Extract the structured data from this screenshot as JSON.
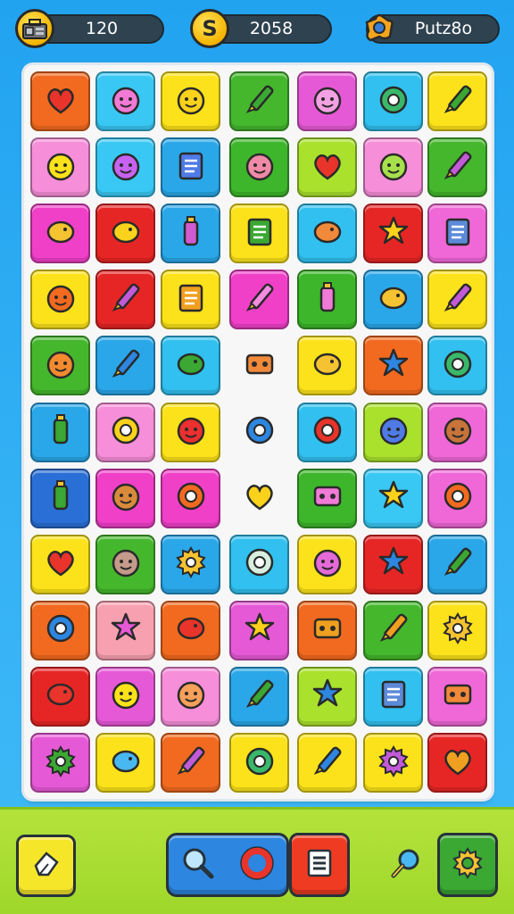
{
  "hud": {
    "stat_left": {
      "value": "120",
      "icon": "toolbox-icon"
    },
    "stat_mid": {
      "value": "2058",
      "icon": "coin-s-icon"
    },
    "stat_right": {
      "value": "Putz8o",
      "icon": "puzzle-piece-icon"
    }
  },
  "board": {
    "rows": [
      [
        {
          "color": "#f26a1f",
          "icon": "apple-icon"
        },
        {
          "color": "#39c8f3",
          "icon": "berry-face-icon"
        },
        {
          "color": "#fbe21b",
          "icon": "sun-face-icon"
        },
        {
          "color": "#45b72d",
          "icon": "brush-icon"
        },
        {
          "color": "#e659d6",
          "icon": "girl-face-icon"
        },
        {
          "color": "#31c0ef",
          "icon": "ring-icon"
        },
        {
          "color": "#fbe21b",
          "icon": "cross-bandage-icon"
        }
      ],
      [
        {
          "color": "#f68ed9",
          "icon": "smiley-icon"
        },
        {
          "color": "#39c8f3",
          "icon": "grape-face-icon"
        },
        {
          "color": "#2aa7e8",
          "icon": "battery-icon"
        },
        {
          "color": "#3db62b",
          "icon": "heart-face-icon"
        },
        {
          "color": "#a9e12d",
          "icon": "strawberry-icon"
        },
        {
          "color": "#f68ed9",
          "icon": "frog-face-icon"
        },
        {
          "color": "#45b72d",
          "icon": "crayon-icon"
        }
      ],
      [
        {
          "color": "#f040c8",
          "icon": "fish-icon"
        },
        {
          "color": "#e62625",
          "icon": "hand-icon"
        },
        {
          "color": "#2aa7e8",
          "icon": "jar-icon"
        },
        {
          "color": "#fbe21b",
          "icon": "ticket-icon"
        },
        {
          "color": "#31c0ef",
          "icon": "cone-icon"
        },
        {
          "color": "#e62625",
          "icon": "flowers-icon"
        },
        {
          "color": "#f068d8",
          "icon": "notebook-icon"
        }
      ],
      [
        {
          "color": "#fbe21b",
          "icon": "bug-face-icon"
        },
        {
          "color": "#e62625",
          "icon": "note-pencil-icon"
        },
        {
          "color": "#fbe21b",
          "icon": "calculator-icon"
        },
        {
          "color": "#f040c8",
          "icon": "eraser-icon"
        },
        {
          "color": "#3db62b",
          "icon": "cup-icon"
        },
        {
          "color": "#2aa7e8",
          "icon": "chick-icon"
        },
        {
          "color": "#fbe21b",
          "icon": "marker-icon"
        }
      ],
      [
        {
          "color": "#45b72d",
          "icon": "orange-face-icon"
        },
        {
          "color": "#2aa7e8",
          "icon": "paint-brush-icon"
        },
        {
          "color": "#31c0ef",
          "icon": "lollipop-icon"
        },
        {
          "color": "",
          "icon": "robot-head-icon"
        },
        {
          "color": "#fbe21b",
          "icon": "candy-icon"
        },
        {
          "color": "#f26a1f",
          "icon": "splat-icon"
        },
        {
          "color": "#31c0ef",
          "icon": "cookie-icon"
        }
      ],
      [
        {
          "color": "#2aa7e8",
          "icon": "bottle-icon"
        },
        {
          "color": "#f68ed9",
          "icon": "lemon-icon"
        },
        {
          "color": "#fbe21b",
          "icon": "devil-face-icon"
        },
        {
          "color": "",
          "icon": "button-icon"
        },
        {
          "color": "#31c0ef",
          "icon": "red-ball-icon"
        },
        {
          "color": "#a9e12d",
          "icon": "blob-face-icon"
        },
        {
          "color": "#f068d8",
          "icon": "monkey-face-icon"
        }
      ],
      [
        {
          "color": "#2a6fd6",
          "icon": "glue-icon"
        },
        {
          "color": "#f040c8",
          "icon": "lion-face-icon"
        },
        {
          "color": "#f040c8",
          "icon": "donut-icon"
        },
        {
          "color": "",
          "icon": "leaf-icon"
        },
        {
          "color": "#3db62b",
          "icon": "toy-car-icon"
        },
        {
          "color": "#39c8f3",
          "icon": "star-flower-icon"
        },
        {
          "color": "#f068d8",
          "icon": "target-icon"
        }
      ],
      [
        {
          "color": "#fbe21b",
          "icon": "balloon-icon"
        },
        {
          "color": "#45b72d",
          "icon": "onion-face-icon"
        },
        {
          "color": "#2aa7e8",
          "icon": "gear-sun-icon"
        },
        {
          "color": "#31c0ef",
          "icon": "clock-icon"
        },
        {
          "color": "#fbe21b",
          "icon": "pig-face-icon"
        },
        {
          "color": "#e62625",
          "icon": "star-icon"
        },
        {
          "color": "#2aa7e8",
          "icon": "wand-icon"
        }
      ],
      [
        {
          "color": "#f26a1f",
          "icon": "ring-blue-icon"
        },
        {
          "color": "#f7a0b0",
          "icon": "puffball-icon"
        },
        {
          "color": "#f26a1f",
          "icon": "ice-pop-icon"
        },
        {
          "color": "#e659d6",
          "icon": "flower-badge-icon"
        },
        {
          "color": "#f26a1f",
          "icon": "lock-icon"
        },
        {
          "color": "#45b72d",
          "icon": "crossed-sticks-icon"
        },
        {
          "color": "#fbe21b",
          "icon": "cog-icon"
        }
      ],
      [
        {
          "color": "#e62625",
          "icon": "muscle-icon"
        },
        {
          "color": "#e659d6",
          "icon": "chick-face-icon"
        },
        {
          "color": "#f68ed9",
          "icon": "peach-face-icon"
        },
        {
          "color": "#2aa7e8",
          "icon": "comb-icon"
        },
        {
          "color": "#a9e12d",
          "icon": "leaf-splat-icon"
        },
        {
          "color": "#31c0ef",
          "icon": "book-icon"
        },
        {
          "color": "#f068d8",
          "icon": "robot-icon"
        }
      ],
      [
        {
          "color": "#e659d6",
          "icon": "green-gear-icon"
        },
        {
          "color": "#fbe21b",
          "icon": "lotus-icon"
        },
        {
          "color": "#f26a1f",
          "icon": "pencil-icon"
        },
        {
          "color": "#fbe21b",
          "icon": "ring-key-icon"
        },
        {
          "color": "#fbe21b",
          "icon": "pen-icon"
        },
        {
          "color": "#fbe21b",
          "icon": "purple-gear-icon"
        },
        {
          "color": "#e62625",
          "icon": "pin-icon"
        }
      ]
    ]
  },
  "toolbar": {
    "left": {
      "icon": "eraser-tool-icon",
      "color": "#f6e62a"
    },
    "search": {
      "icon": "magnifier-icon",
      "color": "#2d86e0"
    },
    "ring": {
      "icon": "donut-ring-icon",
      "color": "#2d86e0"
    },
    "menu": {
      "icon": "list-icon",
      "color": "#ef3b22"
    },
    "hint": {
      "icon": "magnifier-small-icon",
      "color": ""
    },
    "settings": {
      "icon": "gear-icon",
      "color": "#3aa832"
    }
  }
}
